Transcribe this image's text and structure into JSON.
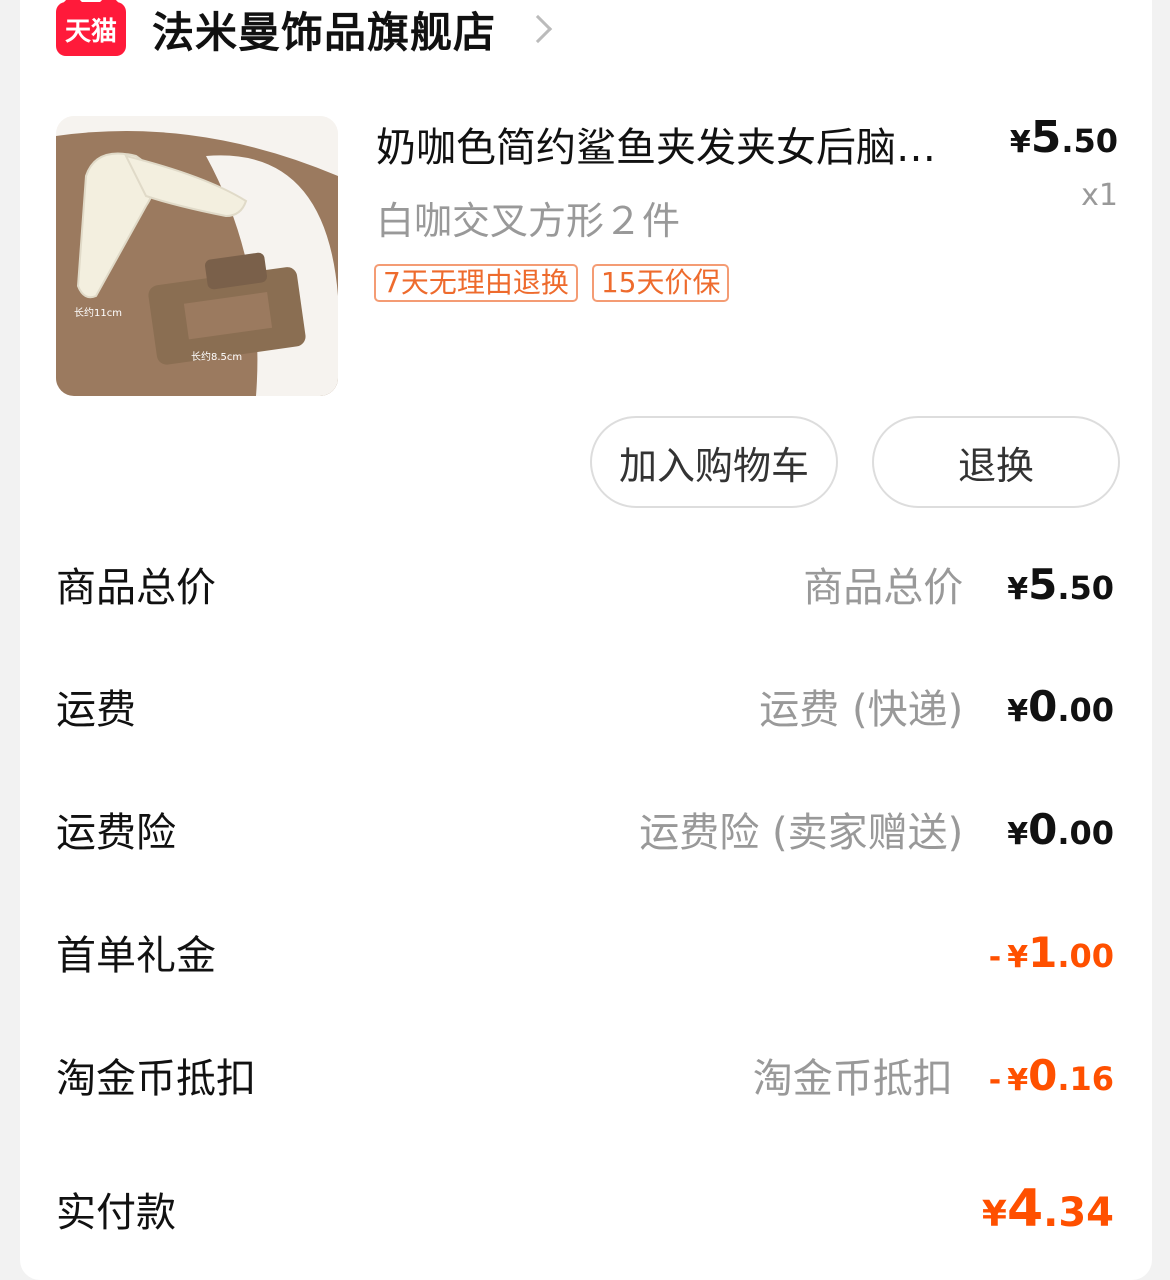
{
  "store": {
    "badge": "天猫",
    "name": "法米曼饰品旗舰店"
  },
  "product": {
    "title": "奶咖色简约鲨鱼夹发夹女后脑勺抓夹",
    "variant": "白咖交叉方形２件",
    "tags": [
      "7天无理由退换",
      "15天价保"
    ],
    "price": {
      "symbol": "¥",
      "int": "5",
      "dec": ".50"
    },
    "qty": "x1",
    "image_labels": [
      "长约11cm",
      "长约8.5cm"
    ]
  },
  "buttons": {
    "add_cart": "加入购物车",
    "return": "退换"
  },
  "summary": [
    {
      "label": "商品总价",
      "desc": "商品总价",
      "minus": "",
      "symbol": "¥",
      "int": "5",
      "dec": ".50"
    },
    {
      "label": "运费",
      "desc": "运费 (快递)",
      "minus": "",
      "symbol": "¥",
      "int": "0",
      "dec": ".00"
    },
    {
      "label": "运费险",
      "desc": "运费险 (卖家赠送)",
      "minus": "",
      "symbol": "¥",
      "int": "0",
      "dec": ".00"
    },
    {
      "label": "首单礼金",
      "desc": "",
      "minus": "-",
      "symbol": "¥",
      "int": "1",
      "dec": ".00"
    },
    {
      "label": "淘金币抵扣",
      "desc": "淘金币抵扣",
      "minus": "-",
      "symbol": "¥",
      "int": "0",
      "dec": ".16"
    }
  ],
  "total": {
    "label": "实付款",
    "symbol": "¥",
    "int": "4",
    "dec": ".34"
  },
  "colors": {
    "accent": "#ff5000",
    "tmall_red": "#ff1a3a",
    "tag_orange": "#ee6b2d"
  }
}
